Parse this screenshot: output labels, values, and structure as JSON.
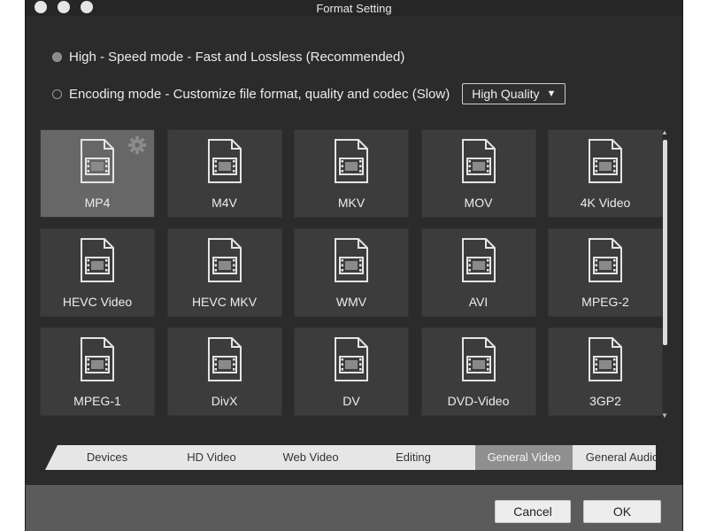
{
  "window": {
    "title": "Format Setting"
  },
  "modes": [
    {
      "label": "High - Speed mode - Fast and Lossless (Recommended)",
      "selected": true
    },
    {
      "label": "Encoding mode - Customize file format, quality and codec (Slow)",
      "selected": false
    }
  ],
  "quality_select": {
    "value": "High Quality",
    "caret": "▼"
  },
  "formats": [
    {
      "label": "MP4",
      "selected": true
    },
    {
      "label": "M4V",
      "selected": false
    },
    {
      "label": "MKV",
      "selected": false
    },
    {
      "label": "MOV",
      "selected": false
    },
    {
      "label": "4K Video",
      "selected": false
    },
    {
      "label": "HEVC Video",
      "selected": false
    },
    {
      "label": "HEVC MKV",
      "selected": false
    },
    {
      "label": "WMV",
      "selected": false
    },
    {
      "label": "AVI",
      "selected": false
    },
    {
      "label": "MPEG-2",
      "selected": false
    },
    {
      "label": "MPEG-1",
      "selected": false
    },
    {
      "label": "DivX",
      "selected": false
    },
    {
      "label": "DV",
      "selected": false
    },
    {
      "label": "DVD-Video",
      "selected": false
    },
    {
      "label": "3GP2",
      "selected": false
    }
  ],
  "tabs": [
    {
      "label": "Devices",
      "active": false
    },
    {
      "label": "HD Video",
      "active": false
    },
    {
      "label": "Web Video",
      "active": false
    },
    {
      "label": "Editing",
      "active": false
    },
    {
      "label": "General Video",
      "active": true
    },
    {
      "label": "General Audio",
      "active": false
    }
  ],
  "buttons": {
    "cancel": "Cancel",
    "ok": "OK"
  },
  "icons": {
    "format_tile": "video-file-icon",
    "settings": "gear-icon"
  },
  "colors": {
    "window_bg": "#2b2b2b",
    "tile_bg": "#3c3c3c",
    "tile_selected_bg": "#676767",
    "footer_bg": "#5b5b5b",
    "tab_bar_bg": "#e6e6e6",
    "tab_active_bg": "#8f8f8f"
  }
}
